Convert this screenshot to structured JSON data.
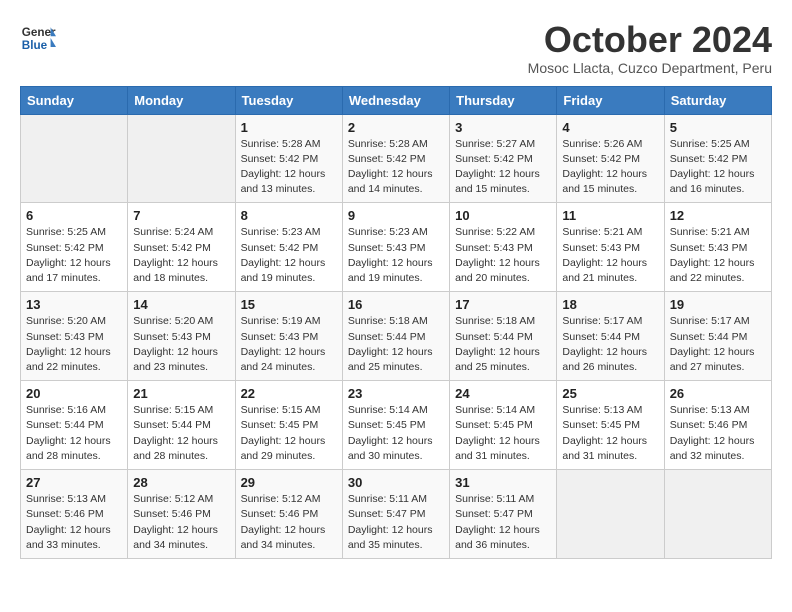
{
  "header": {
    "logo_line1": "General",
    "logo_line2": "Blue",
    "month_title": "October 2024",
    "subtitle": "Mosoc Llacta, Cuzco Department, Peru"
  },
  "days_of_week": [
    "Sunday",
    "Monday",
    "Tuesday",
    "Wednesday",
    "Thursday",
    "Friday",
    "Saturday"
  ],
  "weeks": [
    [
      {
        "num": "",
        "sunrise": "",
        "sunset": "",
        "daylight": ""
      },
      {
        "num": "",
        "sunrise": "",
        "sunset": "",
        "daylight": ""
      },
      {
        "num": "1",
        "sunrise": "Sunrise: 5:28 AM",
        "sunset": "Sunset: 5:42 PM",
        "daylight": "Daylight: 12 hours and 13 minutes."
      },
      {
        "num": "2",
        "sunrise": "Sunrise: 5:28 AM",
        "sunset": "Sunset: 5:42 PM",
        "daylight": "Daylight: 12 hours and 14 minutes."
      },
      {
        "num": "3",
        "sunrise": "Sunrise: 5:27 AM",
        "sunset": "Sunset: 5:42 PM",
        "daylight": "Daylight: 12 hours and 15 minutes."
      },
      {
        "num": "4",
        "sunrise": "Sunrise: 5:26 AM",
        "sunset": "Sunset: 5:42 PM",
        "daylight": "Daylight: 12 hours and 15 minutes."
      },
      {
        "num": "5",
        "sunrise": "Sunrise: 5:25 AM",
        "sunset": "Sunset: 5:42 PM",
        "daylight": "Daylight: 12 hours and 16 minutes."
      }
    ],
    [
      {
        "num": "6",
        "sunrise": "Sunrise: 5:25 AM",
        "sunset": "Sunset: 5:42 PM",
        "daylight": "Daylight: 12 hours and 17 minutes."
      },
      {
        "num": "7",
        "sunrise": "Sunrise: 5:24 AM",
        "sunset": "Sunset: 5:42 PM",
        "daylight": "Daylight: 12 hours and 18 minutes."
      },
      {
        "num": "8",
        "sunrise": "Sunrise: 5:23 AM",
        "sunset": "Sunset: 5:42 PM",
        "daylight": "Daylight: 12 hours and 19 minutes."
      },
      {
        "num": "9",
        "sunrise": "Sunrise: 5:23 AM",
        "sunset": "Sunset: 5:43 PM",
        "daylight": "Daylight: 12 hours and 19 minutes."
      },
      {
        "num": "10",
        "sunrise": "Sunrise: 5:22 AM",
        "sunset": "Sunset: 5:43 PM",
        "daylight": "Daylight: 12 hours and 20 minutes."
      },
      {
        "num": "11",
        "sunrise": "Sunrise: 5:21 AM",
        "sunset": "Sunset: 5:43 PM",
        "daylight": "Daylight: 12 hours and 21 minutes."
      },
      {
        "num": "12",
        "sunrise": "Sunrise: 5:21 AM",
        "sunset": "Sunset: 5:43 PM",
        "daylight": "Daylight: 12 hours and 22 minutes."
      }
    ],
    [
      {
        "num": "13",
        "sunrise": "Sunrise: 5:20 AM",
        "sunset": "Sunset: 5:43 PM",
        "daylight": "Daylight: 12 hours and 22 minutes."
      },
      {
        "num": "14",
        "sunrise": "Sunrise: 5:20 AM",
        "sunset": "Sunset: 5:43 PM",
        "daylight": "Daylight: 12 hours and 23 minutes."
      },
      {
        "num": "15",
        "sunrise": "Sunrise: 5:19 AM",
        "sunset": "Sunset: 5:43 PM",
        "daylight": "Daylight: 12 hours and 24 minutes."
      },
      {
        "num": "16",
        "sunrise": "Sunrise: 5:18 AM",
        "sunset": "Sunset: 5:44 PM",
        "daylight": "Daylight: 12 hours and 25 minutes."
      },
      {
        "num": "17",
        "sunrise": "Sunrise: 5:18 AM",
        "sunset": "Sunset: 5:44 PM",
        "daylight": "Daylight: 12 hours and 25 minutes."
      },
      {
        "num": "18",
        "sunrise": "Sunrise: 5:17 AM",
        "sunset": "Sunset: 5:44 PM",
        "daylight": "Daylight: 12 hours and 26 minutes."
      },
      {
        "num": "19",
        "sunrise": "Sunrise: 5:17 AM",
        "sunset": "Sunset: 5:44 PM",
        "daylight": "Daylight: 12 hours and 27 minutes."
      }
    ],
    [
      {
        "num": "20",
        "sunrise": "Sunrise: 5:16 AM",
        "sunset": "Sunset: 5:44 PM",
        "daylight": "Daylight: 12 hours and 28 minutes."
      },
      {
        "num": "21",
        "sunrise": "Sunrise: 5:15 AM",
        "sunset": "Sunset: 5:44 PM",
        "daylight": "Daylight: 12 hours and 28 minutes."
      },
      {
        "num": "22",
        "sunrise": "Sunrise: 5:15 AM",
        "sunset": "Sunset: 5:45 PM",
        "daylight": "Daylight: 12 hours and 29 minutes."
      },
      {
        "num": "23",
        "sunrise": "Sunrise: 5:14 AM",
        "sunset": "Sunset: 5:45 PM",
        "daylight": "Daylight: 12 hours and 30 minutes."
      },
      {
        "num": "24",
        "sunrise": "Sunrise: 5:14 AM",
        "sunset": "Sunset: 5:45 PM",
        "daylight": "Daylight: 12 hours and 31 minutes."
      },
      {
        "num": "25",
        "sunrise": "Sunrise: 5:13 AM",
        "sunset": "Sunset: 5:45 PM",
        "daylight": "Daylight: 12 hours and 31 minutes."
      },
      {
        "num": "26",
        "sunrise": "Sunrise: 5:13 AM",
        "sunset": "Sunset: 5:46 PM",
        "daylight": "Daylight: 12 hours and 32 minutes."
      }
    ],
    [
      {
        "num": "27",
        "sunrise": "Sunrise: 5:13 AM",
        "sunset": "Sunset: 5:46 PM",
        "daylight": "Daylight: 12 hours and 33 minutes."
      },
      {
        "num": "28",
        "sunrise": "Sunrise: 5:12 AM",
        "sunset": "Sunset: 5:46 PM",
        "daylight": "Daylight: 12 hours and 34 minutes."
      },
      {
        "num": "29",
        "sunrise": "Sunrise: 5:12 AM",
        "sunset": "Sunset: 5:46 PM",
        "daylight": "Daylight: 12 hours and 34 minutes."
      },
      {
        "num": "30",
        "sunrise": "Sunrise: 5:11 AM",
        "sunset": "Sunset: 5:47 PM",
        "daylight": "Daylight: 12 hours and 35 minutes."
      },
      {
        "num": "31",
        "sunrise": "Sunrise: 5:11 AM",
        "sunset": "Sunset: 5:47 PM",
        "daylight": "Daylight: 12 hours and 36 minutes."
      },
      {
        "num": "",
        "sunrise": "",
        "sunset": "",
        "daylight": ""
      },
      {
        "num": "",
        "sunrise": "",
        "sunset": "",
        "daylight": ""
      }
    ]
  ]
}
